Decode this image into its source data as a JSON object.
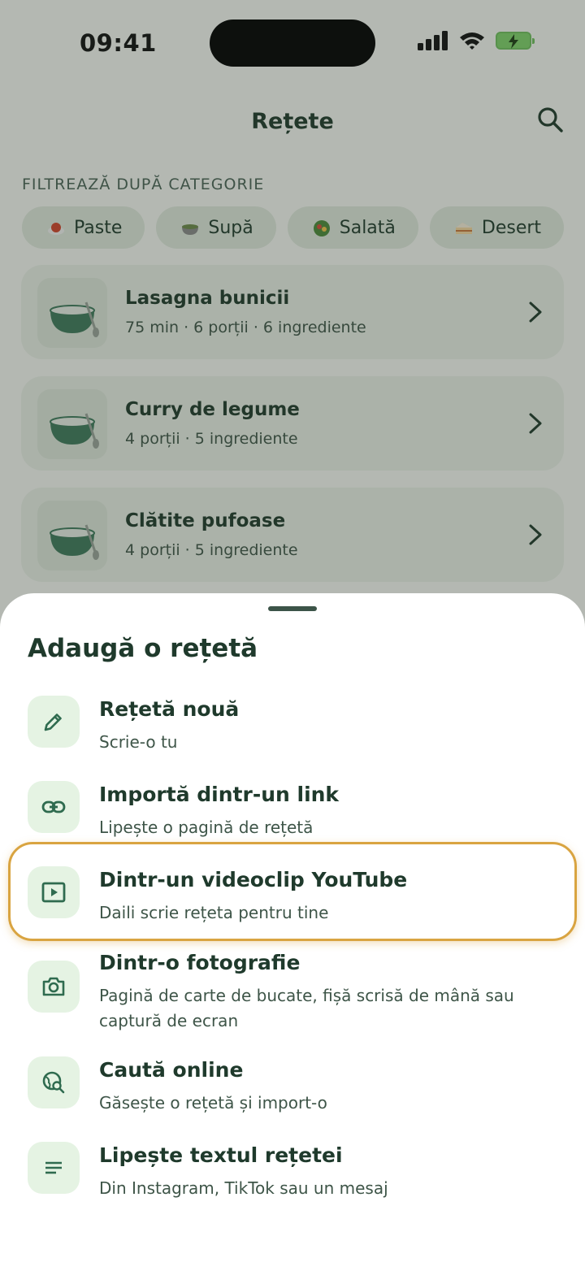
{
  "status": {
    "time": "09:41"
  },
  "header": {
    "title": "Rețete"
  },
  "filters": {
    "label": "FILTREAZĂ DUPĂ CATEGORIE",
    "chips": [
      {
        "label": "Paste",
        "icon": "pasta-icon"
      },
      {
        "label": "Supă",
        "icon": "soup-icon"
      },
      {
        "label": "Salată",
        "icon": "salad-icon"
      },
      {
        "label": "Desert",
        "icon": "cake-icon"
      }
    ]
  },
  "recipes": [
    {
      "name": "Lasagna bunicii",
      "meta": "75 min · 6 porții · 6 ingrediente"
    },
    {
      "name": "Curry de legume",
      "meta": "4 porții · 5 ingrediente"
    },
    {
      "name": "Clătite pufoase",
      "meta": "4 porții · 5 ingrediente"
    }
  ],
  "sheet": {
    "title": "Adaugă o rețetă",
    "options": [
      {
        "label": "Rețetă nouă",
        "sub": "Scrie-o tu",
        "icon": "pencil-icon"
      },
      {
        "label": "Importă dintr-un link",
        "sub": "Lipește o pagină de rețetă",
        "icon": "link-icon"
      },
      {
        "label": "Dintr-un videoclip YouTube",
        "sub": "Daili scrie rețeta pentru tine",
        "icon": "video-icon"
      },
      {
        "label": "Dintr-o fotografie",
        "sub": "Pagină de carte de bucate, fișă scrisă de mână sau captură de ecran",
        "icon": "camera-icon"
      },
      {
        "label": "Caută online",
        "sub": "Găsește o rețetă și import-o",
        "icon": "globe-search-icon"
      },
      {
        "label": "Lipește textul rețetei",
        "sub": "Din Instagram, TikTok sau un mesaj",
        "icon": "text-lines-icon"
      }
    ]
  },
  "colors": {
    "accent": "#2f6b4f",
    "highlight": "#d9a441",
    "icon_bg": "#e5f3e3"
  }
}
